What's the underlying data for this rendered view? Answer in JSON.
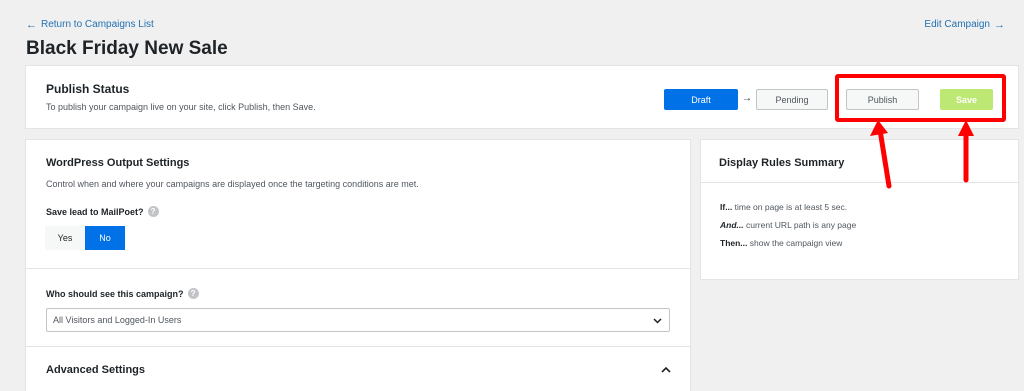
{
  "top_links": {
    "back": "Return to Campaigns List",
    "edit": "Edit Campaign"
  },
  "page_title": "Black Friday New Sale",
  "publish_status": {
    "title": "Publish Status",
    "description": "To publish your campaign live on your site, click Publish, then Save.",
    "steps": {
      "draft": "Draft",
      "pending": "Pending",
      "publish": "Publish",
      "save": "Save"
    },
    "arrow": "→"
  },
  "output_settings": {
    "title": "WordPress Output Settings",
    "description": "Control when and where your campaigns are displayed once the targeting conditions are met.",
    "save_lead_label": "Save lead to MailPoet?",
    "toggle": {
      "yes": "Yes",
      "no": "No",
      "selected": "No"
    },
    "audience_label": "Who should see this campaign?",
    "audience_value": "All Visitors and Logged-In Users",
    "advanced_title": "Advanced Settings",
    "help_glyph": "?"
  },
  "rules_summary": {
    "title": "Display Rules Summary",
    "rules": [
      {
        "prefix": "If...",
        "text": " time on page is at least 5 sec."
      },
      {
        "prefix": "And...",
        "text": " current URL path is any page"
      },
      {
        "prefix": "Then...",
        "text": " show the campaign view"
      }
    ]
  },
  "colors": {
    "accent": "#0071e6",
    "save_button": "#bde873",
    "annotation": "#ff0000",
    "link": "#2271b1"
  }
}
